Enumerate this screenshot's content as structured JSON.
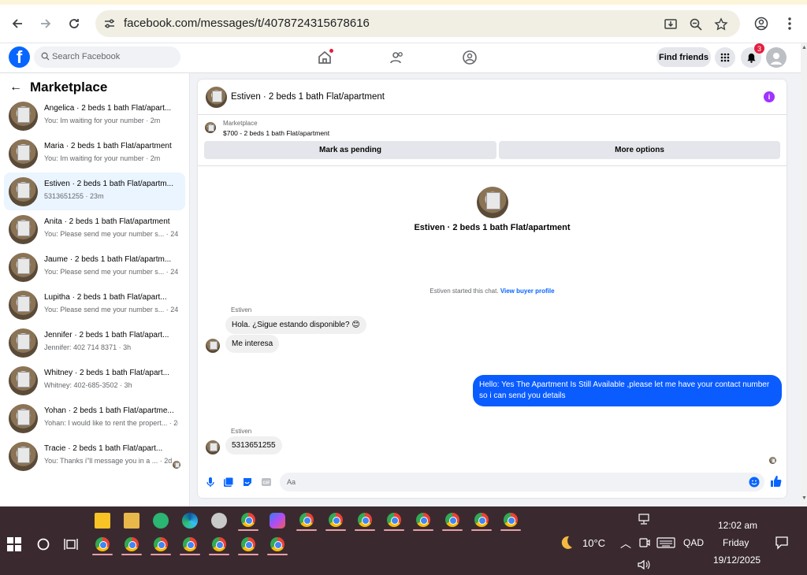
{
  "browser": {
    "url": "facebook.com/messages/t/4078724315678616"
  },
  "header": {
    "search_placeholder": "Search Facebook",
    "find_friends": "Find friends",
    "notification_count": "3"
  },
  "sidebar": {
    "title": "Marketplace",
    "conversations": [
      {
        "name": "Angelica · 2 beds 1 bath Flat/apart...",
        "msg": "You: Im waiting for your number · 2m"
      },
      {
        "name": "Maria · 2 beds 1 bath Flat/apartment",
        "msg": "You: Im waiting for your number · 2m"
      },
      {
        "name": "Estiven · 2 beds 1 bath Flat/apartm...",
        "msg": "5313651255 · 23m"
      },
      {
        "name": "Anita · 2 beds 1 bath Flat/apartment",
        "msg": "You: Please send me your number s... · 24m"
      },
      {
        "name": "Jaume · 2 beds 1 bath Flat/apartm...",
        "msg": "You: Please send me your number s... · 24m"
      },
      {
        "name": "Lupitha · 2 beds 1 bath Flat/apart...",
        "msg": "You: Please send me your number s... · 24m"
      },
      {
        "name": "Jennifer · 2 beds 1 bath Flat/apart...",
        "msg": "Jennifer: 402 714 8371 · 3h"
      },
      {
        "name": "Whitney · 2 beds 1 bath Flat/apart...",
        "msg": "Whitney: 402-685-3502 · 3h"
      },
      {
        "name": "Yohan · 2 beds 1 bath Flat/apartme...",
        "msg": "Yohan: I would like to rent the propert... · 2d"
      },
      {
        "name": "Tracie · 2 beds 1 bath Flat/apart...",
        "msg": "You: Thanks i\"ll message you in a ... · 2d"
      }
    ]
  },
  "chat": {
    "title": "Estiven · 2 beds 1 bath Flat/apartment",
    "marketplace_label": "Marketplace",
    "listing": "$700 - 2 beds 1 bath Flat/apartment",
    "mark_pending": "Mark as pending",
    "more_options": "More options",
    "center_name": "Estiven · 2 beds 1 bath Flat/apartment",
    "started_text": "Estiven started this chat.",
    "view_profile": "View buyer profile",
    "sender": "Estiven",
    "msg1": "Hola. ¿Sigue estando disponible? 😊",
    "msg2": "Me interesa",
    "msg_out": "Hello: Yes The Apartment Is Still Available ,please let me have your contact number so i can send you details",
    "sender2": "Estiven",
    "msg3": "5313651255",
    "composer_placeholder": "Aa"
  },
  "taskbar": {
    "weather": "10°C",
    "lang": "QAD",
    "time": "12:02 am",
    "day": "Friday",
    "date": "19/12/2025"
  }
}
